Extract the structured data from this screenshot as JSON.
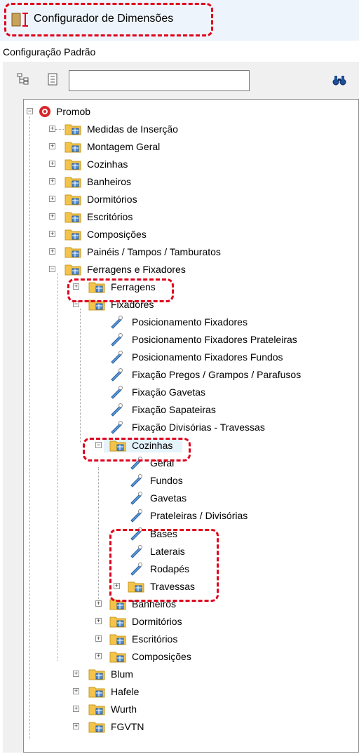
{
  "title": "Configurador de Dimensões",
  "subtitle": "Configuração Padrão",
  "search": {
    "value": ""
  },
  "tree": {
    "root": "Promob",
    "level1": [
      "Medidas de Inserção",
      "Montagem Geral",
      "Cozinhas",
      "Banheiros",
      "Dormitórios",
      "Escritórios",
      "Composições",
      "Painéis / Tampos / Tamburatos",
      "Ferragens e Fixadores"
    ],
    "ferragens": "Ferragens",
    "fixadores": "Fixadores",
    "fixadores_items": [
      "Posicionamento Fixadores",
      "Posicionamento Fixadores Prateleiras",
      "Posicionamento Fixadores Fundos",
      "Fixação Pregos / Grampos / Parafusos",
      "Fixação Gavetas",
      "Fixação Sapateiras",
      "Fixação Divisórias - Travessas"
    ],
    "cozinhas": "Cozinhas",
    "cozinhas_items": [
      "Geral",
      "Fundos",
      "Gavetas",
      "Prateleiras / Divisórias",
      "Bases",
      "Laterais",
      "Rodapés"
    ],
    "travessas": "Travessas",
    "fixadores_after": [
      "Banheiros",
      "Dormitórios",
      "Escritórios",
      "Composições"
    ],
    "level1_after": [
      "Blum",
      "Hafele",
      "Wurth",
      "FGVTN"
    ]
  },
  "colors": {
    "highlight": "#e0001b",
    "folder": "#f4c34a",
    "accent": "#2a7fd4"
  }
}
